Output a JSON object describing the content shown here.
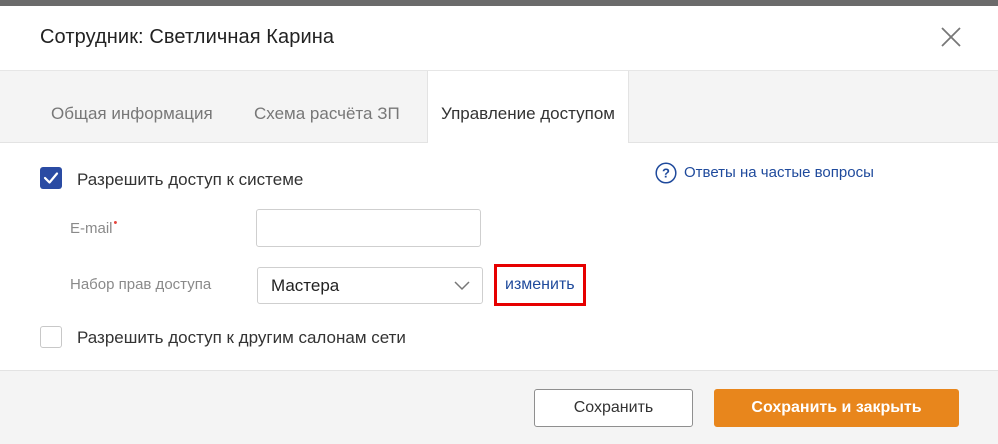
{
  "header": {
    "title": "Сотрудник: Светличная Карина",
    "close_icon": "close-icon"
  },
  "tabs": [
    {
      "label": "Общая информация",
      "active": false
    },
    {
      "label": "Схема расчёта ЗП",
      "active": false
    },
    {
      "label": "Управление доступом",
      "active": true
    }
  ],
  "access": {
    "allow_system_label": "Разрешить доступ к системе",
    "allow_system_checked": true,
    "email_label": "E-mail",
    "email_required_mark": "•",
    "email_value": "",
    "rights_label": "Набор прав доступа",
    "rights_value": "Мастера",
    "change_link": "изменить",
    "allow_network_label": "Разрешить доступ к другим салонам сети",
    "allow_network_checked": false
  },
  "faq": {
    "icon": "question-circle-icon",
    "label": "Ответы на частые вопросы"
  },
  "footer": {
    "save_label": "Сохранить",
    "save_close_label": "Сохранить и закрыть"
  },
  "colors": {
    "accent": "#e8861c",
    "checkbox": "#2a4ba3",
    "link": "#1f4a9c",
    "highlight": "#e60000"
  }
}
